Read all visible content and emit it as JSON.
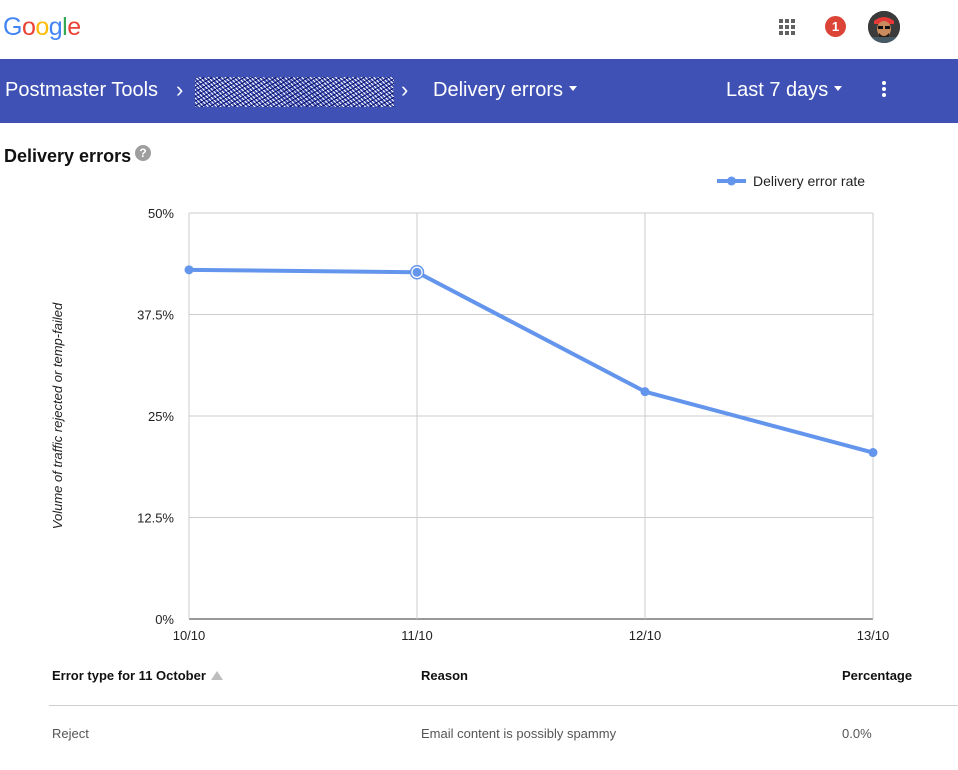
{
  "google_bar": {
    "logo_letters": [
      {
        "ch": "G",
        "color": "#4285F4"
      },
      {
        "ch": "o",
        "color": "#EA4335"
      },
      {
        "ch": "o",
        "color": "#FBBC05"
      },
      {
        "ch": "g",
        "color": "#4285F4"
      },
      {
        "ch": "l",
        "color": "#34A853"
      },
      {
        "ch": "e",
        "color": "#EA4335"
      }
    ],
    "apps_icon": "apps-grid-icon",
    "notification_count": "1",
    "avatar_icon": "user-avatar"
  },
  "nav": {
    "app_title": "Postmaster Tools",
    "separator": "›",
    "domain_label": "",
    "report_label": "Delivery errors",
    "range_label": "Last 7 days",
    "menu_icon": "more-vert-icon",
    "bar_color": "#3f51b5"
  },
  "section": {
    "title": "Delivery errors",
    "help_symbol": "?"
  },
  "chart_data": {
    "type": "line",
    "title": "",
    "xlabel": "",
    "ylabel": "Volume of traffic rejected or temp-failed",
    "x": [
      "10/10",
      "11/10",
      "12/10",
      "13/10"
    ],
    "yticks": [
      "0%",
      "12.5%",
      "25%",
      "37.5%",
      "50%"
    ],
    "ylim": [
      0,
      50
    ],
    "series": [
      {
        "name": "Delivery error rate",
        "values": [
          43.0,
          42.7,
          28.0,
          20.5
        ],
        "color": "#6495ED"
      }
    ],
    "highlighted_index": 1,
    "legend_position": "top-right",
    "grid": true
  },
  "table": {
    "headers": {
      "error_type": "Error type for 11 October",
      "reason": "Reason",
      "percentage": "Percentage"
    },
    "rows": [
      {
        "error_type": "Reject",
        "reason": "Email content is possibly spammy",
        "percentage": "0.0%"
      }
    ]
  }
}
